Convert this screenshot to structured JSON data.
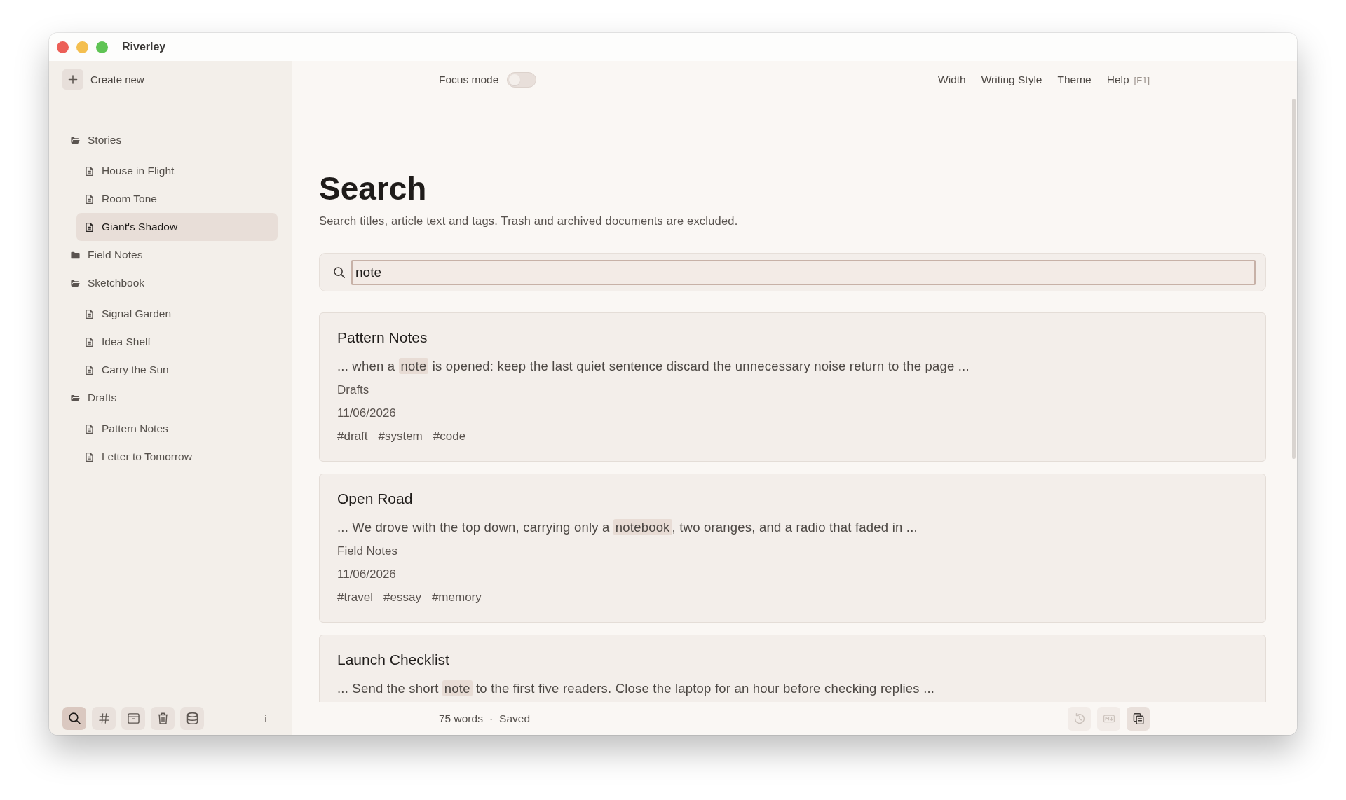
{
  "window": {
    "title": "Riverley"
  },
  "sidebar": {
    "create_button": {
      "label": "Create new"
    },
    "tree": [
      {
        "kind": "folder",
        "label": "Stories",
        "expanded": true,
        "selected": false,
        "children": [
          {
            "kind": "document",
            "label": "House in Flight",
            "selected": false
          },
          {
            "kind": "document",
            "label": "Room Tone",
            "selected": false
          },
          {
            "kind": "document",
            "label": "Giant's Shadow",
            "selected": true
          }
        ]
      },
      {
        "kind": "folder",
        "label": "Field Notes",
        "expanded": false,
        "selected": false
      },
      {
        "kind": "folder",
        "label": "Sketchbook",
        "expanded": true,
        "selected": false,
        "children": [
          {
            "kind": "document",
            "label": "Signal Garden",
            "selected": false
          },
          {
            "kind": "document",
            "label": "Idea Shelf",
            "selected": false
          },
          {
            "kind": "document",
            "label": "Carry the Sun",
            "selected": false
          }
        ]
      },
      {
        "kind": "folder",
        "label": "Drafts",
        "expanded": true,
        "selected": false,
        "children": [
          {
            "kind": "document",
            "label": "Pattern Notes",
            "selected": false
          },
          {
            "kind": "document",
            "label": "Letter to Tomorrow",
            "selected": false
          }
        ]
      }
    ],
    "tools": [
      {
        "kind": "search",
        "selected": true
      },
      {
        "kind": "tags",
        "selected": false
      },
      {
        "kind": "archive",
        "selected": false
      },
      {
        "kind": "trash",
        "selected": false
      },
      {
        "kind": "storage",
        "selected": false
      }
    ],
    "info_button": {
      "label": "i"
    }
  },
  "top_bar": {
    "focus_mode": {
      "label": "Focus mode",
      "on": false
    },
    "menu": [
      {
        "label": "Width"
      },
      {
        "label": "Writing Style"
      },
      {
        "label": "Theme"
      },
      {
        "label": "Help",
        "shortcut": "[F1]"
      }
    ]
  },
  "search": {
    "title": "Search",
    "description": "Search titles, article text and tags. Trash and archived documents are excluded.",
    "field": {
      "value": "note"
    }
  },
  "results": [
    {
      "title": "Pattern Notes",
      "excerpt": [
        {
          "text": "... when a ",
          "highlighted": false
        },
        {
          "text": "note",
          "highlighted": true
        },
        {
          "text": " is opened: keep the last quiet sentence discard the unnecessary noise return to the page ...",
          "highlighted": false
        }
      ],
      "folder": "Drafts",
      "date": "11/06/2026",
      "tags": [
        "#draft",
        "#system",
        "#code"
      ]
    },
    {
      "title": "Open Road",
      "excerpt": [
        {
          "text": "... We drove with the top down, carrying only a ",
          "highlighted": false
        },
        {
          "text": "notebook",
          "highlighted": true
        },
        {
          "text": ", two oranges, and a radio that faded in ...",
          "highlighted": false
        }
      ],
      "folder": "Field Notes",
      "date": "11/06/2026",
      "tags": [
        "#travel",
        "#essay",
        "#memory"
      ]
    },
    {
      "title": "Launch Checklist",
      "excerpt": [
        {
          "text": "... Send the short ",
          "highlighted": false
        },
        {
          "text": "note",
          "highlighted": true
        },
        {
          "text": " to the first five readers. Close the laptop for an hour before checking replies ...",
          "highlighted": false
        }
      ]
    }
  ],
  "status_bar": {
    "word_count": "75 words",
    "separator": "·",
    "save_state": "Saved",
    "actions": [
      {
        "kind": "history",
        "disabled": true
      },
      {
        "kind": "markdown",
        "disabled": true
      },
      {
        "kind": "copy",
        "disabled": false
      }
    ]
  }
}
